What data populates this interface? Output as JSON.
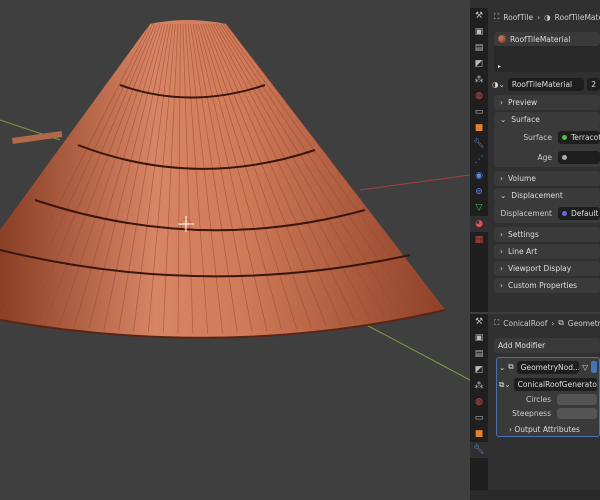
{
  "properties": {
    "breadcrumb": [
      "RoofTile",
      "RoofTileMaterial"
    ],
    "material_slot": "RoofTileMaterial",
    "material_name": "RoofTileMaterial",
    "user_count": "2",
    "sections": {
      "preview": "Preview",
      "surface": "Surface",
      "volume": "Volume",
      "displacement": "Displacement",
      "settings": "Settings",
      "line_art": "Line Art",
      "viewport_display": "Viewport Display",
      "custom_properties": "Custom Properties"
    },
    "surface_label": "Surface",
    "surface_value": "Terracotta",
    "age_label": "Age",
    "displacement_label": "Displacement",
    "displacement_value": "Default"
  },
  "modifiers": {
    "breadcrumb": [
      "ConicalRoof",
      "GeometryNodes"
    ],
    "add_modifier": "Add Modifier",
    "modifier_name": "GeometryNod...",
    "node_group": "ConicalRoofGenerator",
    "circles_label": "Circles",
    "steepness_label": "Steepness",
    "output_attributes": "Output Attributes"
  },
  "colors": {
    "accent": "#4772b3",
    "terracotta": "#c8704f"
  }
}
